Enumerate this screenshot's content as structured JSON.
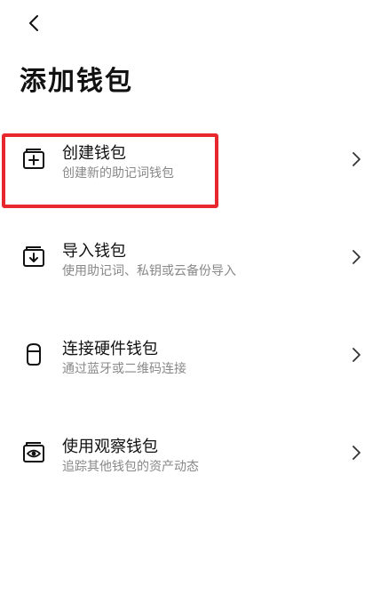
{
  "header": {
    "back_icon": "chevron-left-icon",
    "title": "添加钱包"
  },
  "menu": {
    "items": [
      {
        "title": "创建钱包",
        "desc": "创建新的助记词钱包",
        "icon": "wallet-plus-icon"
      },
      {
        "title": "导入钱包",
        "desc": "使用助记词、私钥或云备份导入",
        "icon": "wallet-import-icon"
      },
      {
        "title": "连接硬件钱包",
        "desc": "通过蓝牙或二维码连接",
        "icon": "hardware-wallet-icon"
      },
      {
        "title": "使用观察钱包",
        "desc": "追踪其他钱包的资产动态",
        "icon": "watch-wallet-icon"
      }
    ]
  },
  "colors": {
    "highlight": "#e8262d",
    "title_text": "#111111",
    "secondary_text": "#888888"
  }
}
